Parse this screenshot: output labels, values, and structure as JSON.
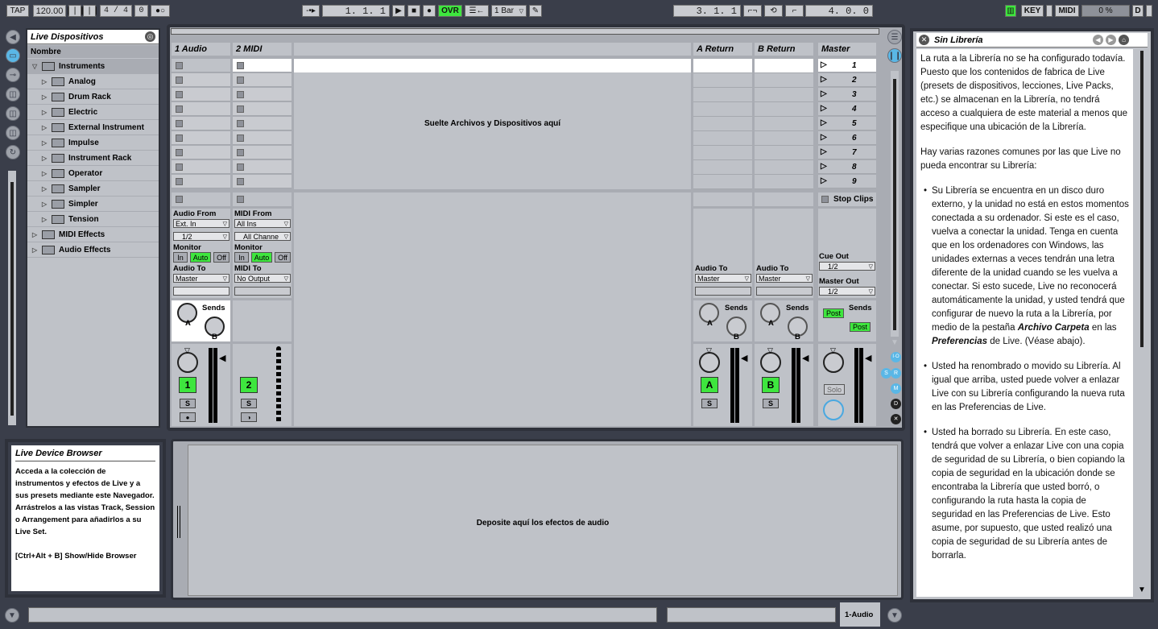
{
  "transport": {
    "tap": "TAP",
    "tempo": "120.00",
    "signature": "4 / 4",
    "metronome": "0",
    "position": "1.   1.   1",
    "ovr": "OVR",
    "quantize": "1 Bar",
    "loop_start": "3.   1.   1",
    "loop_length": "4.   0.   0",
    "key": "KEY",
    "midi": "MIDI",
    "cpu": "0 %",
    "d": "D"
  },
  "browser": {
    "title": "Live Dispositivos",
    "column": "Nombre",
    "items": [
      {
        "label": "Instruments",
        "level": 0
      },
      {
        "label": "Analog",
        "level": 1
      },
      {
        "label": "Drum Rack",
        "level": 1
      },
      {
        "label": "Electric",
        "level": 1
      },
      {
        "label": "External Instrument",
        "level": 1
      },
      {
        "label": "Impulse",
        "level": 1
      },
      {
        "label": "Instrument Rack",
        "level": 1
      },
      {
        "label": "Operator",
        "level": 1
      },
      {
        "label": "Sampler",
        "level": 1
      },
      {
        "label": "Simpler",
        "level": 1
      },
      {
        "label": "Tension",
        "level": 1
      },
      {
        "label": "MIDI Effects",
        "level": 0
      },
      {
        "label": "Audio Effects",
        "level": 0
      }
    ]
  },
  "info": {
    "title": "Live Device Browser",
    "body": "Acceda a la colección de instrumentos y efectos de Live y a sus presets mediante este Navegador. Arrástrelos a las vistas Track, Session o Arrangement para añadirlos a su Live Set.",
    "shortcut": "[Ctrl+Alt + B] Show/Hide Browser"
  },
  "session": {
    "tracks": {
      "audio": "1 Audio",
      "midi": "2 MIDI",
      "return_a": "A Return",
      "return_b": "B Return",
      "master": "Master"
    },
    "drop_files": "Suelte Archivos y Dispositivos aquí",
    "scenes": [
      "1",
      "2",
      "3",
      "4",
      "5",
      "6",
      "7",
      "8",
      "9"
    ],
    "stop_clips": "Stop Clips",
    "io": {
      "audio_from": "Audio From",
      "audio_from_val": "Ext. In",
      "audio_ch": "1/2",
      "midi_from": "MIDI From",
      "midi_from_val": "All Ins",
      "midi_ch": "All Channe",
      "monitor": "Monitor",
      "in": "In",
      "auto": "Auto",
      "off": "Off",
      "audio_to": "Audio To",
      "audio_to_val": "Master",
      "midi_to": "MIDI To",
      "midi_to_val": "No Output",
      "cue_out": "Cue Out",
      "cue_val": "1/2",
      "master_out": "Master Out",
      "master_val": "1/2"
    },
    "sends": "Sends",
    "post": "Post",
    "knob_a": "A",
    "knob_b": "B",
    "num_1": "1",
    "num_2": "2",
    "num_a": "A",
    "num_b": "B",
    "solo_s": "S",
    "solo": "Solo"
  },
  "device_drop": "Deposite aquí los efectos de audio",
  "status": {
    "track": "1-Audio"
  },
  "help": {
    "title": "Sin Librería",
    "p1": "La ruta a la Librería no se ha configurado todavía. Puesto que los contenidos de fabrica de Live (presets de dispositivos, lecciones, Live Packs, etc.) se almacenan en la Librería, no tendrá acceso a cualquiera de este material a menos que especifique una ubicación de la Librería.",
    "p2": "Hay varias razones comunes por las que Live no pueda encontrar su Librería:",
    "b1a": "Su Librería se encuentra en un disco duro externo, y la unidad no está en estos momentos conectada a su ordenador. Si este es el caso, vuelva a conectar la unidad. Tenga en cuenta que en los ordenadores con Windows, las unidades externas a veces tendrán una letra diferente de la unidad cuando se les vuelva a conectar. Si esto sucede, Live no reconocerá automáticamente la unidad, y usted tendrá que configurar de nuevo la ruta a la Librería, por medio de la pestaña",
    "b1b": "Archivo Carpeta",
    "b1c": "en las",
    "b1d": "Preferencias",
    "b1e": "de Live. (Véase abajo).",
    "b2": "Usted ha renombrado o movido su Librería. Al igual que arriba, usted puede volver a enlazar Live con su Librería configurando la nueva ruta en las Preferencias de Live.",
    "b3": "Usted ha borrado su Librería. En este caso, tendrá que volver a enlazar Live con una copia de seguridad de su Librería, o bien copiando la copia de seguridad en la ubicación donde se encontraba la Librería que usted borró, o configurando la ruta hasta la copia de seguridad en las Preferencias de Live. Esto asume, por supuesto, que usted realizó una copia de seguridad de su Librería antes de borrarla."
  }
}
